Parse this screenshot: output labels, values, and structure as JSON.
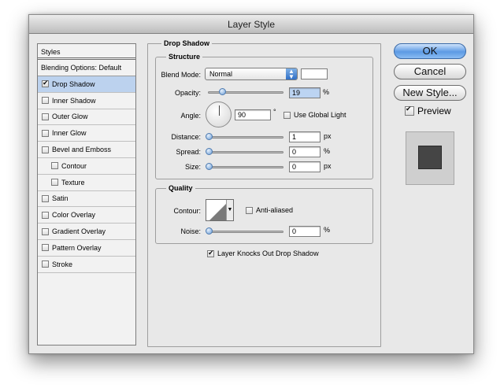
{
  "window": {
    "title": "Layer Style"
  },
  "styles_panel": {
    "header": "Styles",
    "blending": "Blending Options: Default",
    "items": [
      {
        "label": "Drop Shadow",
        "checked": true,
        "selected": true,
        "sub": false
      },
      {
        "label": "Inner Shadow",
        "checked": false,
        "selected": false,
        "sub": false
      },
      {
        "label": "Outer Glow",
        "checked": false,
        "selected": false,
        "sub": false
      },
      {
        "label": "Inner Glow",
        "checked": false,
        "selected": false,
        "sub": false
      },
      {
        "label": "Bevel and Emboss",
        "checked": false,
        "selected": false,
        "sub": false
      },
      {
        "label": "Contour",
        "checked": false,
        "selected": false,
        "sub": true
      },
      {
        "label": "Texture",
        "checked": false,
        "selected": false,
        "sub": true
      },
      {
        "label": "Satin",
        "checked": false,
        "selected": false,
        "sub": false
      },
      {
        "label": "Color Overlay",
        "checked": false,
        "selected": false,
        "sub": false
      },
      {
        "label": "Gradient Overlay",
        "checked": false,
        "selected": false,
        "sub": false
      },
      {
        "label": "Pattern Overlay",
        "checked": false,
        "selected": false,
        "sub": false
      },
      {
        "label": "Stroke",
        "checked": false,
        "selected": false,
        "sub": false
      }
    ]
  },
  "drop_shadow": {
    "title": "Drop Shadow",
    "structure": {
      "title": "Structure",
      "blend_mode_label": "Blend Mode:",
      "blend_mode_value": "Normal",
      "shadow_color": "#ffffff",
      "opacity_label": "Opacity:",
      "opacity_value": "19",
      "opacity_unit": "%",
      "angle_label": "Angle:",
      "angle_value": "90",
      "angle_unit": "°",
      "global_light_label": "Use Global Light",
      "global_light_checked": false,
      "distance_label": "Distance:",
      "distance_value": "1",
      "distance_unit": "px",
      "spread_label": "Spread:",
      "spread_value": "0",
      "spread_unit": "%",
      "size_label": "Size:",
      "size_value": "0",
      "size_unit": "px"
    },
    "quality": {
      "title": "Quality",
      "contour_label": "Contour:",
      "anti_aliased_label": "Anti-aliased",
      "anti_aliased_checked": false,
      "noise_label": "Noise:",
      "noise_value": "0",
      "noise_unit": "%"
    },
    "knockout_label": "Layer Knocks Out Drop Shadow",
    "knockout_checked": true
  },
  "buttons": {
    "ok": "OK",
    "cancel": "Cancel",
    "new_style": "New Style...",
    "preview_label": "Preview",
    "preview_checked": true
  },
  "colors": {
    "selection": "#bcd2ee",
    "accent": "#5c9ae4",
    "preview_swatch": "#454545"
  }
}
